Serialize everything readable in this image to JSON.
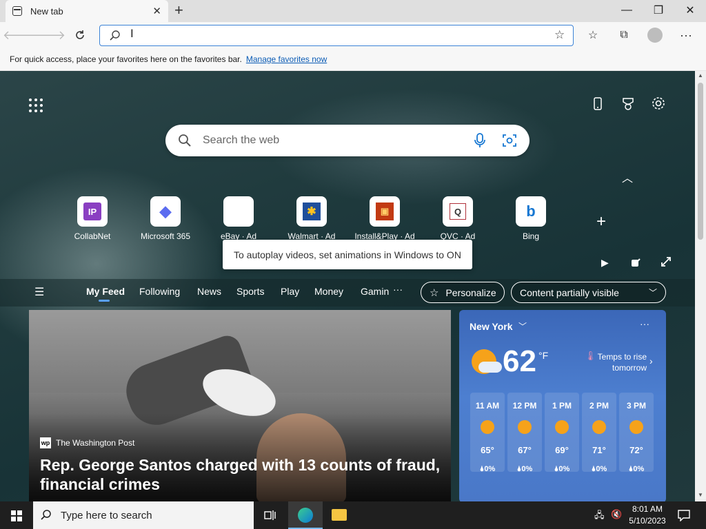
{
  "browser": {
    "tab_title": "New tab",
    "tab_close_glyph": "✕",
    "new_tab_glyph": "+",
    "address_value": "",
    "window": {
      "minimize": "—",
      "maximize": "❐",
      "close": "✕"
    }
  },
  "favorites_bar": {
    "message": "For quick access, place your favorites here on the favorites bar.",
    "link": "Manage favorites now"
  },
  "newtab": {
    "search_placeholder": "Search the web",
    "quick_links": [
      {
        "label": "CollabNet",
        "tile": "IP",
        "color": "#8a3fc2"
      },
      {
        "label": "Microsoft 365",
        "tile": "◆",
        "color": "#5b6cf0"
      },
      {
        "label": "eBay · Ad",
        "tile": "🛍",
        "color": "#e53238"
      },
      {
        "label": "Walmart · Ad",
        "tile": "✱",
        "color": "#1f4f9c"
      },
      {
        "label": "Install&Play · Ad",
        "tile": "▣",
        "color": "#c23a12"
      },
      {
        "label": "QVC · Ad",
        "tile": "Q",
        "color": "#b0303a"
      },
      {
        "label": "Bing",
        "tile": "b",
        "color": "#1677d2"
      }
    ],
    "tooltip": "To autoplay videos, set animations in Windows to ON",
    "feed_nav": [
      "My Feed",
      "Following",
      "News",
      "Sports",
      "Play",
      "Money",
      "Gamin"
    ],
    "more_glyph": "···",
    "personalize": "Personalize",
    "content_visibility": "Content partially visible"
  },
  "article": {
    "source": "The Washington Post",
    "source_logo": "wp",
    "headline_line1": "Rep. George Santos charged with 13 counts of fraud,",
    "headline_line2": "financial crimes"
  },
  "weather": {
    "location": "New York",
    "temp": "62",
    "unit": "°F",
    "note_line1": "Temps to rise",
    "note_line2": "tomorrow",
    "hours": [
      {
        "time": "11 AM",
        "temp": "65°",
        "precip": "0%"
      },
      {
        "time": "12 PM",
        "temp": "67°",
        "precip": "0%"
      },
      {
        "time": "1 PM",
        "temp": "69°",
        "precip": "0%"
      },
      {
        "time": "2 PM",
        "temp": "71°",
        "precip": "0%"
      },
      {
        "time": "3 PM",
        "temp": "72°",
        "precip": "0%"
      }
    ]
  },
  "taskbar": {
    "search_placeholder": "Type here to search",
    "time": "8:01 AM",
    "date": "5/10/2023"
  },
  "colors": {
    "accent": "#0a5bb5",
    "weather_bg": "#4a78c8",
    "sun": "#f6a21a"
  }
}
